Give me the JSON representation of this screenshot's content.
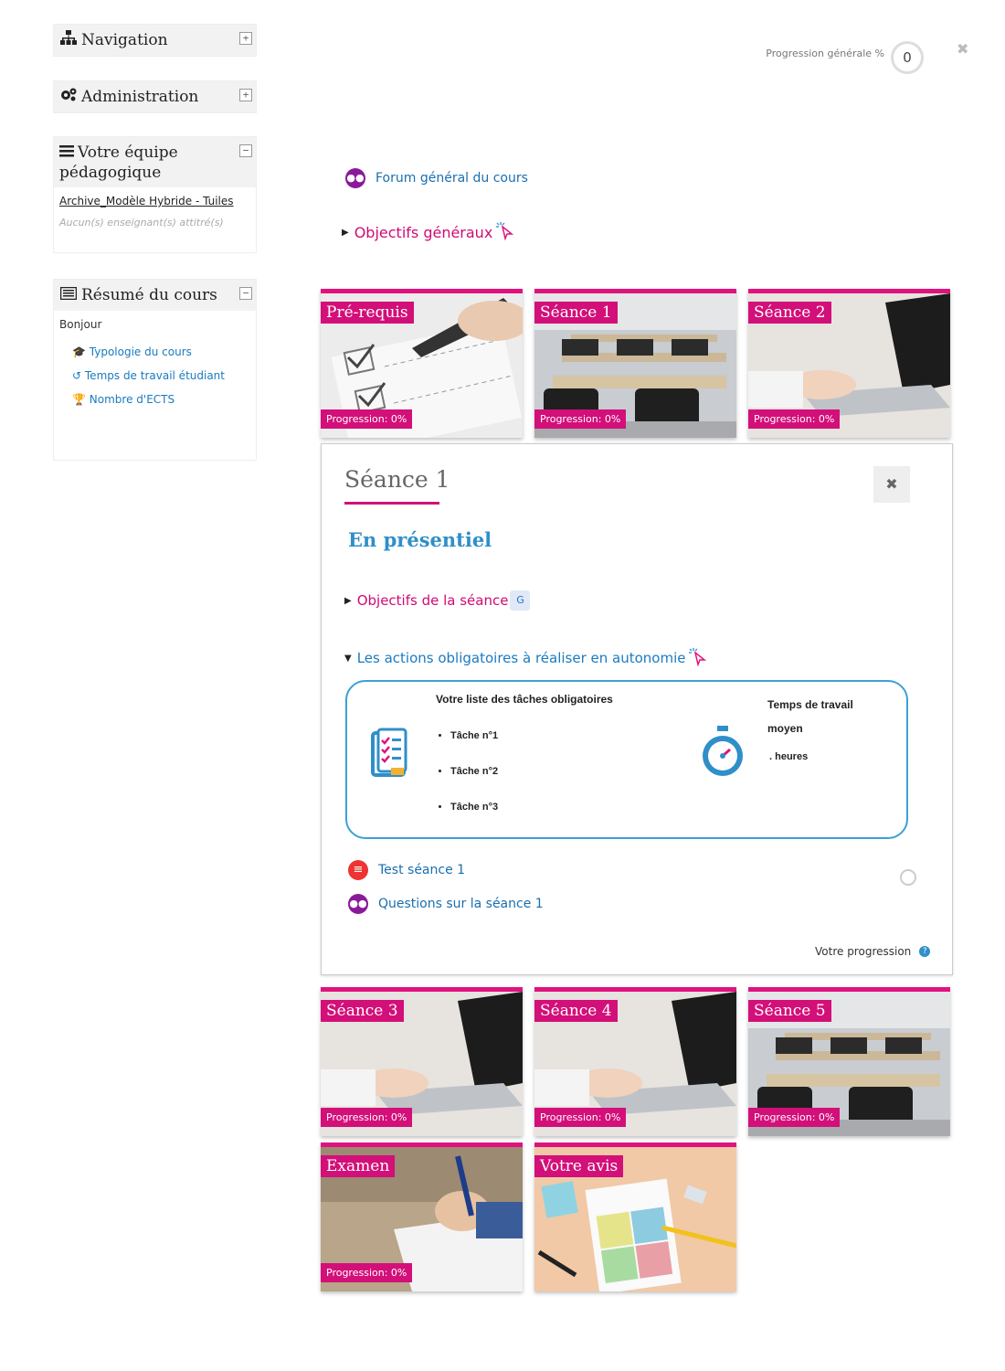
{
  "sidebar": {
    "navigation": {
      "title": "Navigation",
      "icon": "sitemap-icon"
    },
    "administration": {
      "title": "Administration",
      "icon": "cogs-icon"
    },
    "team": {
      "title_line1": "Votre équipe",
      "title_line2": "pédagogique",
      "link": "Archive_Modèle Hybride - Tuiles",
      "note": "Aucun(s) enseignant(s) attitré(s)"
    },
    "summary": {
      "title": "Résumé du cours",
      "greeting": "Bonjour",
      "links": [
        "Typologie du cours",
        "Temps de travail étudiant",
        "Nombre d'ECTS"
      ]
    }
  },
  "header": {
    "progress_label": "Progression générale %",
    "progress_value": "0"
  },
  "course": {
    "forum": "Forum général du cours",
    "objectives": "Objectifs généraux"
  },
  "tiles": [
    {
      "title": "Pré-requis",
      "progress": "Progression: 0%",
      "image": "checklist-photo"
    },
    {
      "title": "Séance 1",
      "progress": "Progression: 0%",
      "image": "classroom-photo"
    },
    {
      "title": "Séance 2",
      "progress": "Progression: 0%",
      "image": "laptop-photo"
    },
    {
      "title": "Séance 3",
      "progress": "Progression: 0%",
      "image": "laptop-photo"
    },
    {
      "title": "Séance 4",
      "progress": "Progression: 0%",
      "image": "laptop-photo"
    },
    {
      "title": "Séance 5",
      "progress": "Progression: 0%",
      "image": "classroom-photo"
    },
    {
      "title": "Examen",
      "progress": "Progression: 0%",
      "image": "writing-photo"
    },
    {
      "title": "Votre avis",
      "progress": "",
      "image": "feedback-photo"
    }
  ],
  "session": {
    "title": "Séance 1",
    "subtitle": "En présentiel",
    "objectives": "Objectifs de la séance",
    "actions": "Les actions obligatoires à réaliser en autonomie",
    "tasks_title": "Votre liste des tâches obligatoires",
    "tasks": [
      "Tâche n°1",
      "Tâche n°2",
      "Tâche n°3"
    ],
    "time_title_1": "Temps de travail",
    "time_title_2": "moyen",
    "time_value": ". heures",
    "test": "Test séance 1",
    "questions": "Questions sur la séance 1",
    "progress_label": "Votre progression"
  },
  "colors": {
    "accent": "#d30f79",
    "link": "#1a7bbf",
    "heading_blue": "#2f8fc9"
  }
}
